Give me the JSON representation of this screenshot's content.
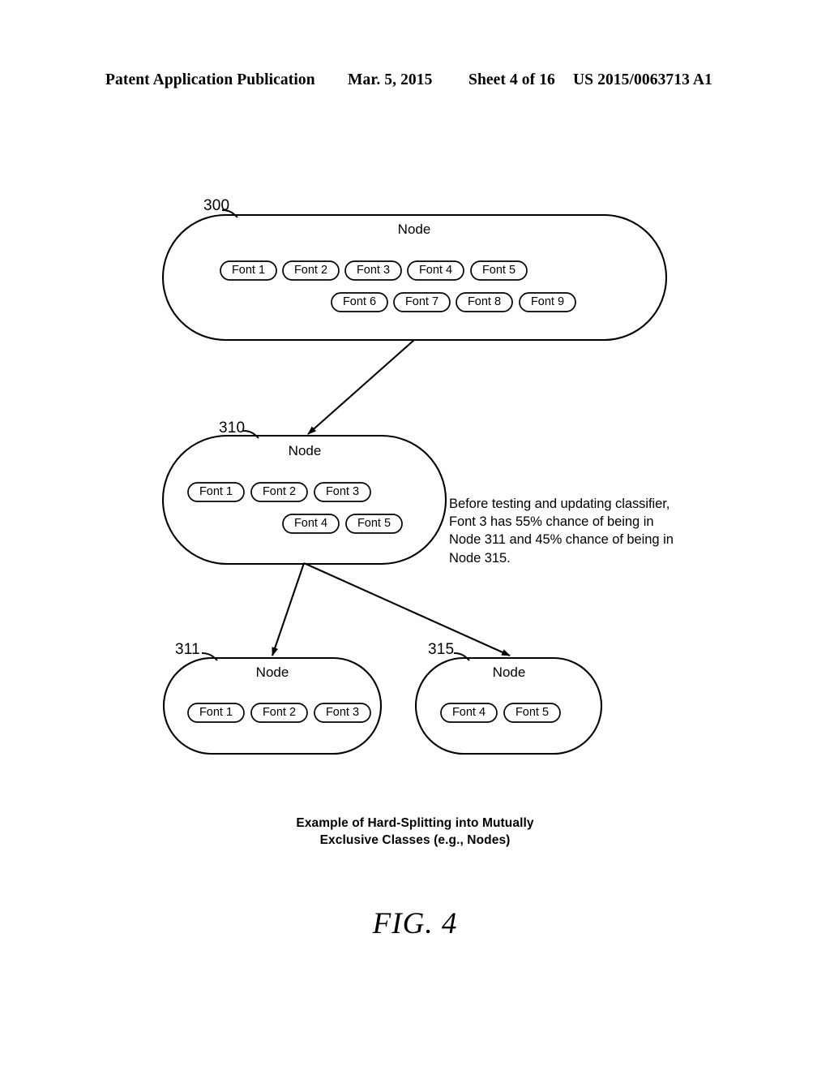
{
  "header": {
    "publication": "Patent Application Publication",
    "date": "Mar. 5, 2015",
    "sheet": "Sheet 4 of 16",
    "patent_number": "US 2015/0063713 A1"
  },
  "figure": {
    "label": "FIG. 4",
    "caption_line1": "Example of Hard-Splitting into Mutually",
    "caption_line2": "Exclusive Classes (e.g., Nodes)",
    "annotation": "Before testing and updating classifier,\nFont 3 has 55% chance of being in\nNode 311 and 45% chance of being in\nNode 315.",
    "stroke_color": "#000000",
    "fill_color": "#ffffff"
  },
  "nodes": [
    {
      "ref": "300",
      "title": "Node",
      "rows": [
        [
          "Font 1",
          "Font 2",
          "Font 3",
          "Font 4",
          "Font 5"
        ],
        [
          "Font 6",
          "Font 7",
          "Font 8",
          "Font 9"
        ]
      ]
    },
    {
      "ref": "310",
      "title": "Node",
      "rows": [
        [
          "Font 1",
          "Font 2",
          "Font 3"
        ],
        [
          "Font 4",
          "Font 5"
        ]
      ]
    },
    {
      "ref": "311",
      "title": "Node",
      "rows": [
        [
          "Font 1",
          "Font 2",
          "Font 3"
        ]
      ]
    },
    {
      "ref": "315",
      "title": "Node",
      "rows": [
        [
          "Font 4",
          "Font 5"
        ]
      ]
    }
  ],
  "edges": [
    {
      "from": "300",
      "to": "310"
    },
    {
      "from": "310",
      "to": "311"
    },
    {
      "from": "310",
      "to": "315"
    }
  ]
}
